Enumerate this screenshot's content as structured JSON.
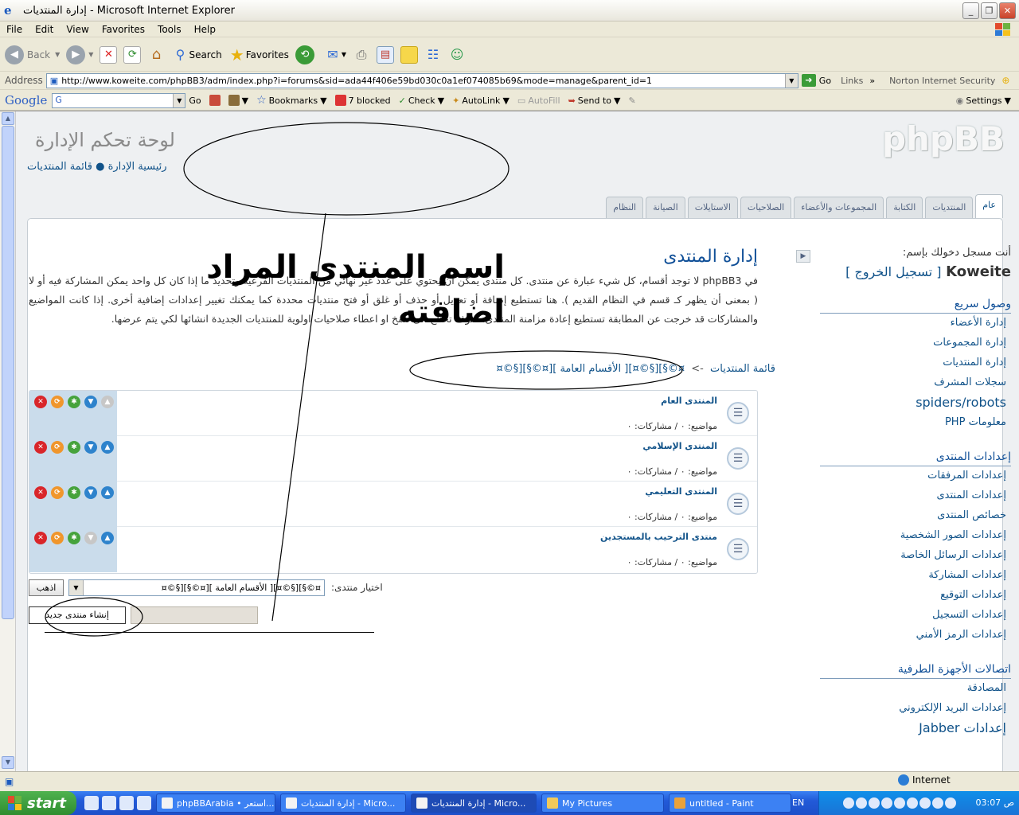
{
  "window": {
    "title": "إدارة المنتديات - Microsoft Internet Explorer",
    "buttons": [
      "_",
      "❐",
      "✕"
    ]
  },
  "menubar": [
    "File",
    "Edit",
    "View",
    "Favorites",
    "Tools",
    "Help"
  ],
  "toolbar": {
    "back": "Back",
    "search": "Search",
    "favorites": "Favorites"
  },
  "address": {
    "label": "Address",
    "url": "http://www.koweite.com/phpBB3/adm/index.php?i=forums&sid=ada44f406e59bd030c0a1ef074085b69&mode=manage&parent_id=1",
    "go": "Go",
    "links": "Links",
    "norton": "Norton Internet Security"
  },
  "googlebar": {
    "logo": "Google",
    "go": "Go",
    "bookmarks": "Bookmarks",
    "blocked": "7 blocked",
    "check": "Check",
    "autolink": "AutoLink",
    "autofill": "AutoFill",
    "sendto": "Send to",
    "settings": "Settings"
  },
  "acp": {
    "title": "لوحة تحكم الإدارة",
    "breadcrumb": "رئيسية الإدارة ● قائمة المنتديات",
    "logo": "phpBB",
    "tabs": [
      "عام",
      "المنتديات",
      "الكتابة",
      "المجموعات والأعضاء",
      "الصلاحيات",
      "الاستايلات",
      "الصيانة",
      "النظام"
    ]
  },
  "sidebar": {
    "logged_in_as": "أنت مسجل دخولك بإسم:",
    "username": "Koweite",
    "logout": "[ تسجيل الخروج ]",
    "sections": [
      {
        "title": "وصول سريع",
        "items": [
          "إدارة الأعضاء",
          "إدارة المجموعات",
          "إدارة المنتديات",
          "سجلات المشرف",
          "spiders/robots",
          "معلومات PHP"
        ]
      },
      {
        "title": "إعدادات المنتدى",
        "items": [
          "إعدادات المرفقات",
          "إعدادات المنتدى",
          "خصائص المنتدى",
          "إعدادات الصور الشخصية",
          "إعدادات الرسائل الخاصة",
          "إعدادات المشاركة",
          "إعدادات التوقيع",
          "إعدادات التسجيل",
          "إعدادات الرمز الأمني"
        ]
      },
      {
        "title": "اتصالات الأجهزة الطرفية",
        "items": [
          "المصادقة",
          "إعدادات البريد الإلكتروني",
          "إعدادات Jabber"
        ]
      }
    ]
  },
  "main": {
    "heading": "إدارة المنتدى",
    "description": "في phpBB3 لا توجد أقسام، كل شيء عبارة عن منتدى. كل منتدى يمكن أن يحتوي على عدد غير نهائي من المنتديات الفرعية وتحديد ما إذا كان كل واحد يمكن المشاركة فيه أو لا ( بمعنى أن يظهر كـ قسم في النظام القديم ). هنا تستطيع إضافة أو تعديل أو حذف أو غلق أو فتح منتديات محددة كما يمكنك تغيير إعدادات إضافية أخرى. إذا كانت المواضيع والمشاركات قد خرجت عن المطابقة تستطيع إعادة مزامنة المنتدى. سوف تحتاج الى نسخ او اعطاء صلاحيات اولوية للمنتديات الجديدة انشائها لكي يتم عرضها.",
    "crumb_root": "قائمة المنتديات",
    "crumb_arrow": "->",
    "crumb_current": "¤©§][§©¤][ الأقسام العامة ][¤©§][§©¤",
    "forums": [
      {
        "name": "المنتدى العام",
        "stats": "مواضيع: ٠ / مشاركات: ٠"
      },
      {
        "name": "المنتدى الإسلامي",
        "stats": "مواضيع: ٠ / مشاركات: ٠"
      },
      {
        "name": "المنتدى التعليمي",
        "stats": "مواضيع: ٠ / مشاركات: ٠"
      },
      {
        "name": "منتدى الترحيب بالمستجدين",
        "stats": "مواضيع: ٠ / مشاركات: ٠"
      }
    ],
    "jump_label": "اختيار منتدى:",
    "jump_value": "¤©§][§©¤][ الأقسام العامة ][¤©§][§©¤",
    "jump_go": "اذهب",
    "create_forum": "إنشاء منتدى جديد"
  },
  "annotation": {
    "text": "اسم المنتدى المراد اضافته"
  },
  "status": {
    "zone": "Internet"
  },
  "taskbar": {
    "start": "start",
    "tasks": [
      "phpBBArabia • استعر...",
      "إدارة المنتديات - Micro...",
      "إدارة المنتديات - Micro...",
      "My Pictures",
      "untitled - Paint"
    ],
    "lang": "EN",
    "clock": "03:07 ص"
  }
}
